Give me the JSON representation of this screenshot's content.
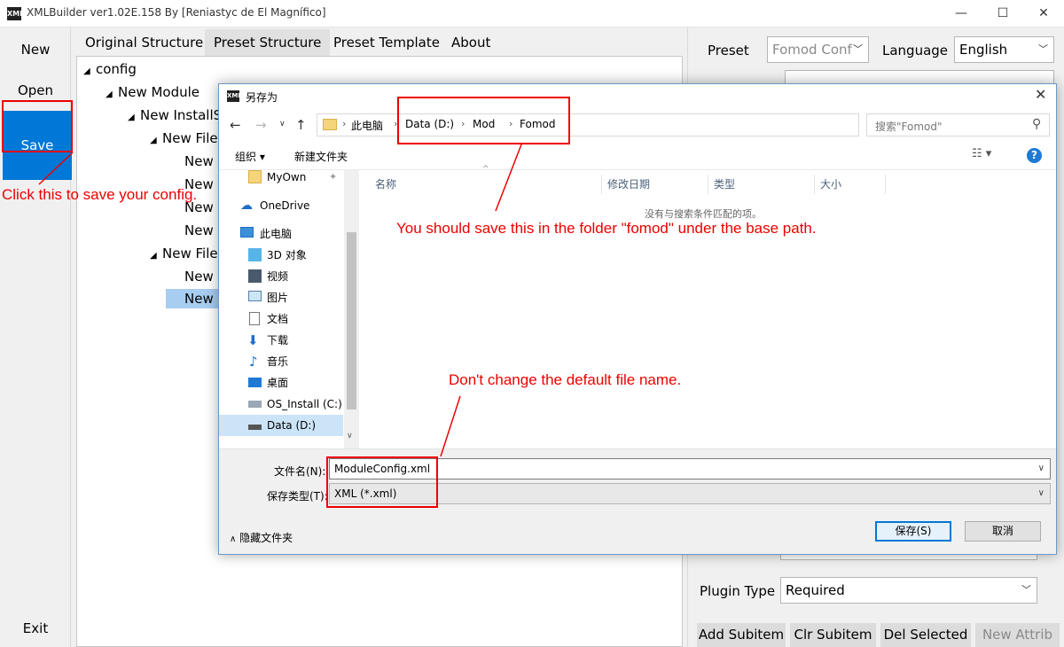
{
  "window": {
    "title": "XMLBuilder ver1.02E.158 By [Reniastyc de El Magnífico]",
    "icon": "xml-app-icon",
    "icon_text": "XML",
    "controls": {
      "minimize": "—",
      "maximize": "☐",
      "close": "✕"
    }
  },
  "leftnav": {
    "new": "New",
    "open": "Open",
    "save": "Save",
    "exit": "Exit"
  },
  "tabs": [
    "Original Structure",
    "Preset Structure",
    "Preset Template",
    "About"
  ],
  "tree": {
    "nodes": [
      {
        "label": "config",
        "expanded": true
      },
      {
        "label": "New Module",
        "expanded": true
      },
      {
        "label": "New InstallSt",
        "expanded": true
      },
      {
        "label": "New FileG",
        "expanded": true
      },
      {
        "label": "New I"
      },
      {
        "label": "New I"
      },
      {
        "label": "New I"
      },
      {
        "label": "New I"
      },
      {
        "label": "New FileG",
        "expanded": true
      },
      {
        "label": "New I"
      },
      {
        "label": "New I",
        "selected": true
      }
    ]
  },
  "right_panel": {
    "preset_label": "Preset",
    "preset_value": "Fomod Conf",
    "language_label": "Language",
    "language_value": "English",
    "plugin_type_label": "Plugin Type",
    "plugin_type_value": "Required",
    "buttons": {
      "add_subitem": "Add Subitem",
      "clr_subitem": "Clr Subitem",
      "del_selected": "Del Selected",
      "new_attrib": "New Attrib"
    }
  },
  "dialog": {
    "title": "另存为",
    "icon_text": "XML",
    "breadcrumb": [
      "此电脑",
      "Data (D:)",
      "Mod",
      "Fomod"
    ],
    "search_placeholder": "搜索\"Fomod\"",
    "toolbar": {
      "organize": "组织 ▾",
      "new_folder": "新建文件夹"
    },
    "sidebar": [
      {
        "label": "MyOwn",
        "icon": "folder-icon",
        "pinned": true
      },
      {
        "label": "OneDrive",
        "icon": "cloud-icon"
      },
      {
        "label": "此电脑",
        "icon": "computer-icon"
      },
      {
        "label": "3D 对象",
        "icon": "cube-icon"
      },
      {
        "label": "视频",
        "icon": "video-icon"
      },
      {
        "label": "图片",
        "icon": "picture-icon"
      },
      {
        "label": "文档",
        "icon": "document-icon"
      },
      {
        "label": "下载",
        "icon": "download-icon"
      },
      {
        "label": "音乐",
        "icon": "music-icon"
      },
      {
        "label": "桌面",
        "icon": "desktop-icon"
      },
      {
        "label": "OS_Install (C:)",
        "icon": "drive-icon"
      },
      {
        "label": "Data (D:)",
        "icon": "drive-icon",
        "selected": true
      }
    ],
    "columns": [
      "名称",
      "修改日期",
      "类型",
      "大小"
    ],
    "empty_message": "没有与搜索条件匹配的项。",
    "filename_label": "文件名(N):",
    "filename_value": "ModuleConfig.xml",
    "type_label": "保存类型(T):",
    "type_value": "XML (*.xml)",
    "hide_folders": "隐藏文件夹",
    "save_button": "保存(S)",
    "cancel_button": "取消"
  },
  "annotations": {
    "save_note": "Click this to save your config.",
    "folder_note": "You should save this in the folder \"fomod\" under the base path.",
    "filename_note": "Don't change the default file name.",
    "color": "#e00000"
  }
}
